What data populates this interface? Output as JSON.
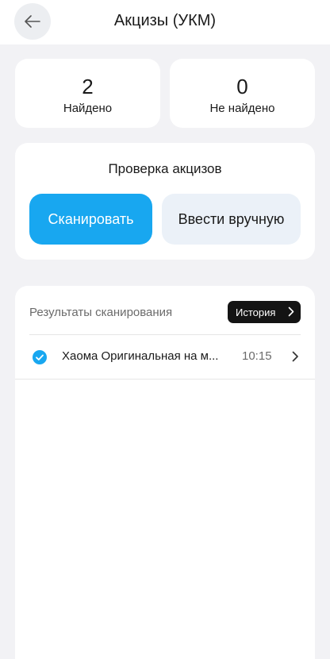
{
  "header": {
    "title": "Акцизы (УКМ)",
    "back_icon": "arrow-left-icon"
  },
  "stats": {
    "found": {
      "value": "2",
      "label": "Найдено"
    },
    "not_found": {
      "value": "0",
      "label": "Не найдено"
    }
  },
  "check": {
    "title": "Проверка акцизов",
    "scan_label": "Сканировать",
    "manual_label": "Ввести вручную"
  },
  "results": {
    "title": "Результаты сканирования",
    "history_label": "История",
    "items": [
      {
        "name": "Хаома Оригинальная на м...",
        "time": "10:15",
        "status_icon": "check-circle-icon"
      }
    ]
  },
  "colors": {
    "accent": "#18a7f0",
    "background": "#f2f2f5",
    "card": "#ffffff",
    "secondary_button": "#ebf1f8",
    "history_button": "#141414"
  }
}
